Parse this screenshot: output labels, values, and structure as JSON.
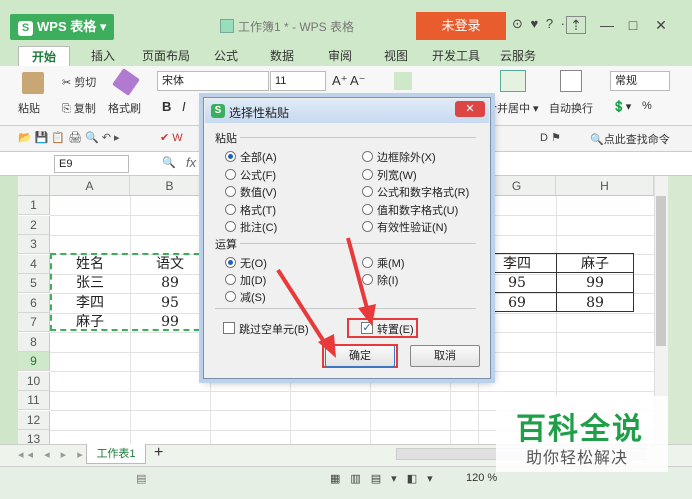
{
  "app": {
    "name": "WPS 表格",
    "logo": "S",
    "doc_title": "工作簿1 * - WPS 表格",
    "login": "未登录"
  },
  "title_icons": "⊙ ♥ ? ·",
  "ribbon_tabs": [
    "开始",
    "插入",
    "页面布局",
    "公式",
    "数据",
    "审阅",
    "视图",
    "开发工具",
    "云服务"
  ],
  "ribbon": {
    "paste": "粘贴",
    "cut": "剪切",
    "copy": "复制",
    "format_painter": "格式刷",
    "font": "宋体",
    "font_size": "11",
    "grow": "A⁺",
    "shrink": "A⁻",
    "bold": "B",
    "italic": "I",
    "merge_center": "合并居中",
    "wrap": "自动换行",
    "number_format": "常规",
    "percent": "%",
    "find_cmd": "点此查找命令"
  },
  "formula": {
    "cell_ref": "E9",
    "fx": "fx"
  },
  "columns": [
    "A",
    "B",
    "C",
    "D",
    "E",
    "F",
    "G",
    "H"
  ],
  "rows": [
    "1",
    "2",
    "3",
    "4",
    "5",
    "6",
    "7",
    "8",
    "9",
    "10",
    "11",
    "12",
    "13"
  ],
  "table_left": {
    "row4": [
      "姓名",
      "语文"
    ],
    "row5": [
      "张三",
      "89"
    ],
    "row6": [
      "李四",
      "95"
    ],
    "row7": [
      "麻子",
      "99"
    ]
  },
  "table_right": {
    "header": [
      "李四",
      "麻子"
    ],
    "r5": [
      "95",
      "99"
    ],
    "r6": [
      "69",
      "89"
    ]
  },
  "sheet": {
    "tab": "工作表1",
    "add": "+"
  },
  "status": {
    "zoom": "120 %"
  },
  "dialog": {
    "title": "选择性粘贴",
    "logo": "S",
    "paste_group": "粘贴",
    "paste_options_left": [
      "全部(A)",
      "公式(F)",
      "数值(V)",
      "格式(T)",
      "批注(C)"
    ],
    "paste_options_right": [
      "边框除外(X)",
      "列宽(W)",
      "公式和数字格式(R)",
      "值和数字格式(U)",
      "有效性验证(N)"
    ],
    "op_group": "运算",
    "op_left": [
      "无(O)",
      "加(D)",
      "减(S)"
    ],
    "op_right": [
      "乘(M)",
      "除(I)"
    ],
    "skip_blanks": "跳过空单元(B)",
    "transpose": "转置(E)",
    "transpose_checked": true,
    "ok": "确定",
    "cancel": "取消"
  },
  "watermark": {
    "title": "百科全说",
    "subtitle": "助你轻松解决"
  },
  "colors": {
    "accent": "#3cae5c",
    "login": "#e95c2d",
    "highlight": "#e83a3a",
    "watermark": "#1e9f48"
  }
}
